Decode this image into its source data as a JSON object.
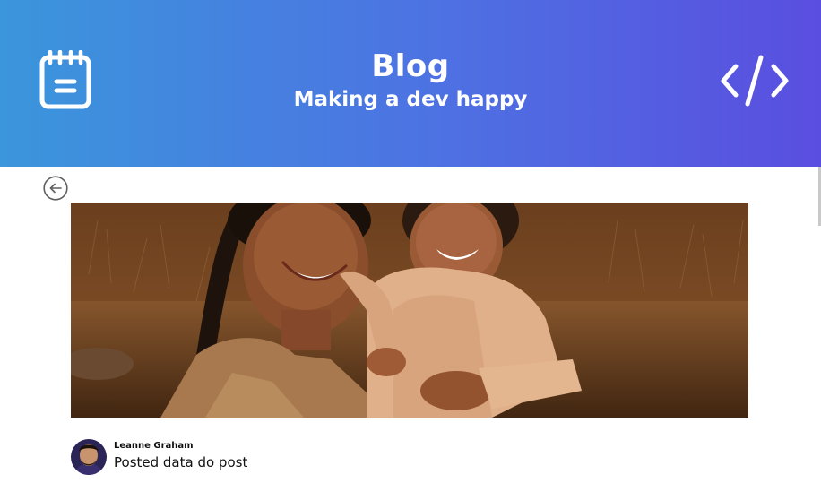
{
  "header": {
    "title": "Blog",
    "subtitle": "Making a dev happy",
    "left_icon": "notepad-icon",
    "right_icon": "code-icon",
    "gradient_start": "#3b96dc",
    "gradient_end": "#5a4ee0"
  },
  "navigation": {
    "back_icon": "arrow-left-circle-icon"
  },
  "post": {
    "hero_image": "photo-smiling-woman-holding-child-in-field",
    "author": {
      "name": "Leanne Graham",
      "date_text": "Posted data do post"
    }
  }
}
